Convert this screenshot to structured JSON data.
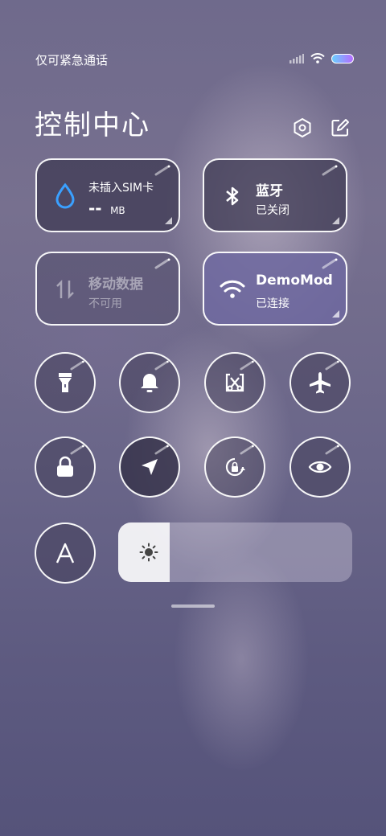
{
  "status_bar": {
    "carrier": "仅可紧急通话"
  },
  "header": {
    "title": "控制中心"
  },
  "tiles": {
    "data_usage": {
      "title": "未插入SIM卡",
      "value": "--",
      "unit": "MB"
    },
    "bluetooth": {
      "title": "蓝牙",
      "status": "已关闭"
    },
    "mobile_data": {
      "title": "移动数据",
      "status": "不可用"
    },
    "wifi": {
      "title": "DemoMod",
      "status": "已连接"
    }
  },
  "toggles": [
    {
      "name": "flashlight",
      "icon": "flashlight-icon",
      "on": false
    },
    {
      "name": "mute",
      "icon": "bell-icon",
      "on": false
    },
    {
      "name": "screenshot",
      "icon": "scissors-icon",
      "on": false
    },
    {
      "name": "airplane-mode",
      "icon": "airplane-icon",
      "on": false
    },
    {
      "name": "lock-screen",
      "icon": "lock-icon",
      "on": false
    },
    {
      "name": "location",
      "icon": "location-arrow-icon",
      "on": true
    },
    {
      "name": "rotation-lock",
      "icon": "rotation-lock-icon",
      "on": false
    },
    {
      "name": "reading-mode",
      "icon": "eye-icon",
      "on": false
    },
    {
      "name": "auto-brightness",
      "icon": "letter-a-icon",
      "on": false
    }
  ],
  "brightness": {
    "level_percent": 22,
    "icon": "sun-icon"
  },
  "colors": {
    "active_tile": "#6e69a0",
    "tile": "#3c3850",
    "battery_gradient": [
      "#6ad0ff",
      "#b56bff"
    ]
  }
}
